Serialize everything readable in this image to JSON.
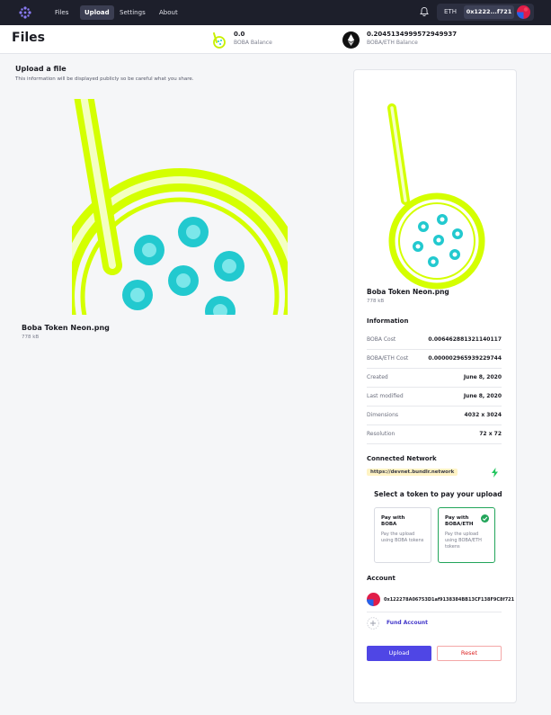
{
  "nav": {
    "tabs": [
      {
        "label": "Files"
      },
      {
        "label": "Upload"
      },
      {
        "label": "Settings"
      },
      {
        "label": "About"
      }
    ],
    "active_tab": "Upload",
    "currency": "ETH",
    "wallet_address_short": "0x1222...f721"
  },
  "header": {
    "title": "Files",
    "balances": [
      {
        "value": "0.0",
        "label": "BOBA Balance",
        "icon": "boba-token-icon"
      },
      {
        "value": "0.2045134999572949937",
        "label": "BOBA/ETH Balance",
        "icon": "ethereum-icon"
      }
    ]
  },
  "upload": {
    "heading": "Upload a file",
    "subtext": "This information will be displayed publicly so be careful what you share.",
    "file_name": "Boba Token Neon.png",
    "file_size": "778 kB"
  },
  "details": {
    "file_name": "Boba Token Neon.png",
    "file_size": "778 kB",
    "information_title": "Information",
    "rows": [
      {
        "key": "BOBA Cost",
        "value": "0.006462881321140117"
      },
      {
        "key": "BOBA/ETH Cost",
        "value": "0.000002965939229744"
      },
      {
        "key": "Created",
        "value": "June 8, 2020"
      },
      {
        "key": "Last modified",
        "value": "June 8, 2020"
      },
      {
        "key": "Dimensions",
        "value": "4032 x 3024"
      },
      {
        "key": "Resolution",
        "value": "72 x 72"
      }
    ],
    "network_title": "Connected Network",
    "network_url": "https://devnet.bundlr.network",
    "pay_title": "Select a token to pay your upload",
    "pay_options": [
      {
        "title": "Pay with BOBA",
        "desc": "Pay the upload using BOBA tokens",
        "selected": false
      },
      {
        "title": "Pay with BOBA/ETH",
        "desc": "Pay the upload using BOBA/ETH tokens",
        "selected": true
      }
    ],
    "account_title": "Account",
    "account_address": "0x122278A06753D1af9138384BB13CF138F9C8f721",
    "fund_label": "Fund Account",
    "upload_button": "Upload",
    "reset_button": "Reset"
  },
  "colors": {
    "topbar": "#1d1f2b",
    "accent": "#4f46e5",
    "neon_green": "#d4ff00",
    "pearl": "#22c9cf",
    "success": "#22a55a",
    "danger": "#dc2626"
  }
}
